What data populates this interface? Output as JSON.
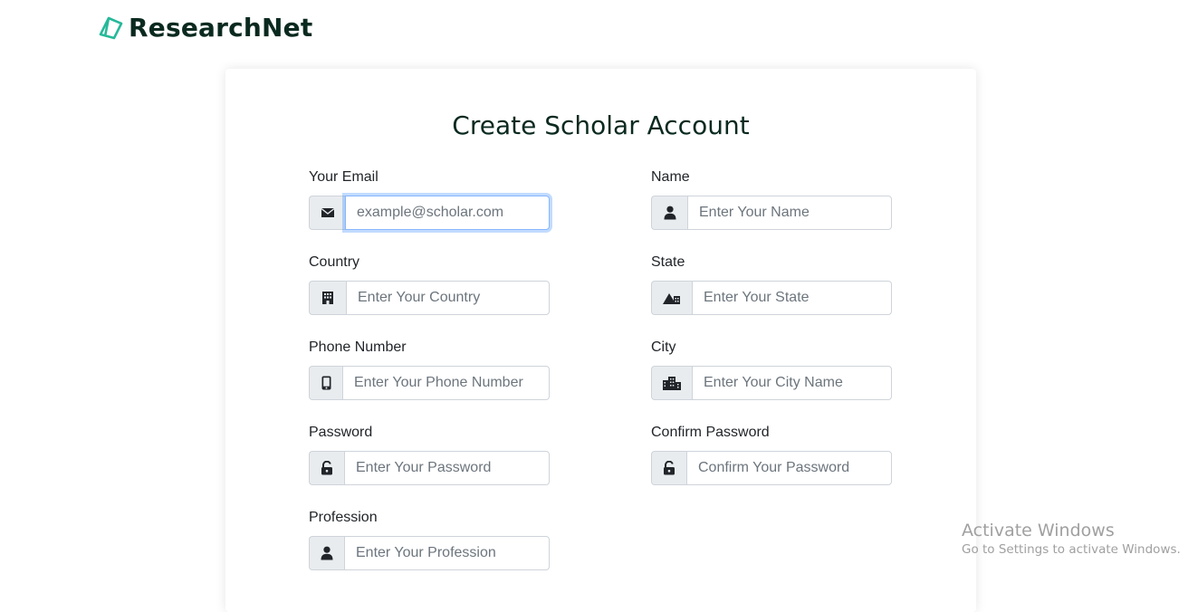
{
  "brand": {
    "name": "ResearchNet",
    "color": "#0b2a1f",
    "logo_color": "#26b999"
  },
  "form": {
    "title": "Create Scholar Account",
    "fields": {
      "email": {
        "label": "Your Email",
        "placeholder": "example@scholar.com",
        "icon": "envelope-icon"
      },
      "name": {
        "label": "Name",
        "placeholder": "Enter Your Name",
        "icon": "user-icon"
      },
      "country": {
        "label": "Country",
        "placeholder": "Enter Your Country",
        "icon": "building-icon"
      },
      "state": {
        "label": "State",
        "placeholder": "Enter Your State",
        "icon": "mountain-city-icon"
      },
      "phone": {
        "label": "Phone Number",
        "placeholder": "Enter Your Phone Number",
        "icon": "mobile-icon"
      },
      "city": {
        "label": "City",
        "placeholder": "Enter Your City Name",
        "icon": "city-icon"
      },
      "password": {
        "label": "Password",
        "placeholder": "Enter Your Password",
        "icon": "unlock-icon"
      },
      "confirm_password": {
        "label": "Confirm Password",
        "placeholder": "Confirm Your Password",
        "icon": "unlock-icon"
      },
      "profession": {
        "label": "Profession",
        "placeholder": "Enter Your Profession",
        "icon": "user-icon"
      }
    }
  },
  "watermark": {
    "title": "Activate Windows",
    "subtitle": "Go to Settings to activate Windows."
  }
}
